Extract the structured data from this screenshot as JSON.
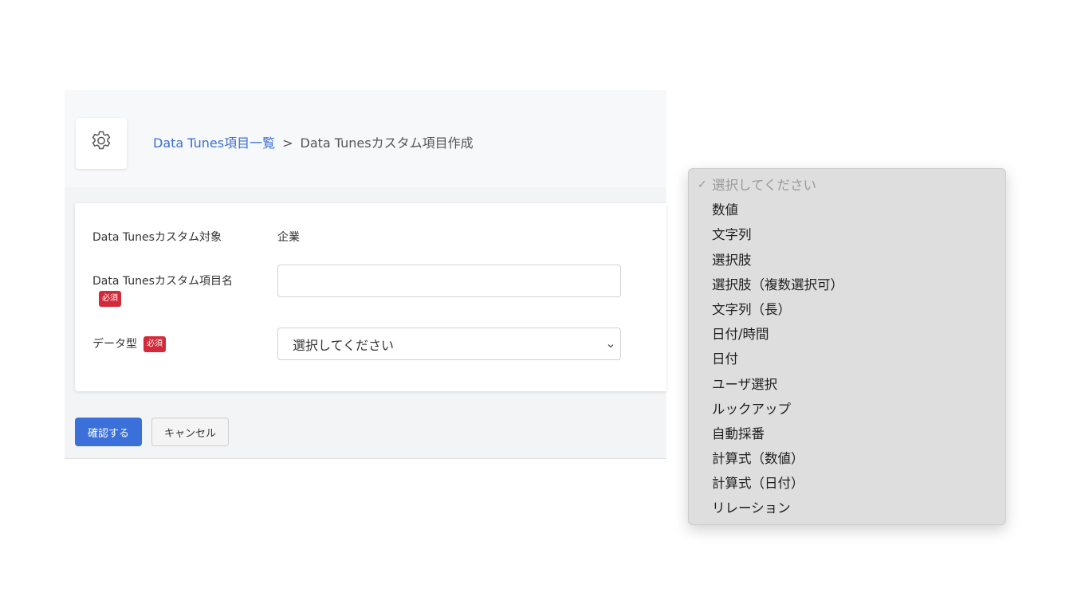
{
  "breadcrumb": {
    "link_label": "Data Tunes項目一覧",
    "separator": ">",
    "current": "Data Tunesカスタム項目作成"
  },
  "header": {
    "icon": "gear-icon"
  },
  "form": {
    "target": {
      "label": "Data Tunesカスタム対象",
      "value": "企業"
    },
    "item_name": {
      "label": "Data Tunesカスタム項目名",
      "required_badge": "必須",
      "value": ""
    },
    "data_type": {
      "label": "データ型",
      "required_badge": "必須",
      "selected": "選択してください",
      "icon": "chevron-down-icon"
    }
  },
  "buttons": {
    "confirm": "確認する",
    "cancel": "キャンセル"
  },
  "dropdown": {
    "checkmark": "✓",
    "options": [
      "選択してください",
      "数値",
      "文字列",
      "選択肢",
      "選択肢（複数選択可）",
      "文字列（長）",
      "日付/時間",
      "日付",
      "ユーザ選択",
      "ルックアップ",
      "自動採番",
      "計算式（数値）",
      "計算式（日付）",
      "リレーション"
    ]
  },
  "colors": {
    "accent": "#3b6fd9",
    "link": "#3a6fd8",
    "required": "#d22a3a"
  }
}
